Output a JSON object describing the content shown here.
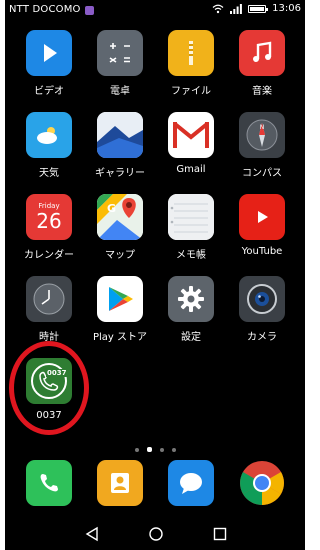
{
  "status": {
    "carrier": "NTT DOCOMO",
    "time": "13:06"
  },
  "apps": [
    {
      "label": "ビデオ"
    },
    {
      "label": "電卓"
    },
    {
      "label": "ファイル"
    },
    {
      "label": "音楽"
    },
    {
      "label": "天気"
    },
    {
      "label": "ギャラリー"
    },
    {
      "label": "Gmail"
    },
    {
      "label": "コンパス"
    },
    {
      "label": "カレンダー",
      "calendar_day": "Friday",
      "calendar_date": "26"
    },
    {
      "label": "マップ"
    },
    {
      "label": "メモ帳"
    },
    {
      "label": "YouTube"
    },
    {
      "label": "時計"
    },
    {
      "label": "Play ストア"
    },
    {
      "label": "設定"
    },
    {
      "label": "カメラ"
    },
    {
      "label": "0037",
      "icon_text": "0037"
    }
  ],
  "page_indicator": {
    "count": 4,
    "active": 1
  },
  "dock": [
    {
      "icon": "phone-icon"
    },
    {
      "icon": "contacts-icon"
    },
    {
      "icon": "messages-icon"
    },
    {
      "icon": "chrome-icon"
    }
  ],
  "navbar": [
    "back-icon",
    "home-icon",
    "recents-icon"
  ],
  "colors": {
    "highlight": "#e0161f",
    "app_0037_bg": "#2e7d32"
  }
}
